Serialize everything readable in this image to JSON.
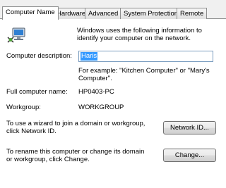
{
  "tabs": [
    {
      "label": "Computer Name",
      "active": true
    },
    {
      "label": "Hardware"
    },
    {
      "label": "Advanced"
    },
    {
      "label": "System Protection"
    },
    {
      "label": "Remote"
    }
  ],
  "intro": "Windows uses the following information to identify your computer on the network.",
  "description": {
    "label": "Computer description:",
    "value": "Haris",
    "example": "For example: \"Kitchen Computer\" or \"Mary's Computer\"."
  },
  "full_name": {
    "label": "Full computer name:",
    "value": "HP0403-PC"
  },
  "workgroup": {
    "label": "Workgroup:",
    "value": "WORKGROUP"
  },
  "network_id": {
    "text": "To use a wizard to join a domain or workgroup, click Network ID.",
    "button": "Network ID..."
  },
  "rename": {
    "text": "To rename this computer or change its domain or workgroup, click Change.",
    "button": "Change..."
  },
  "icons": {
    "computer": "computer-network-icon"
  }
}
